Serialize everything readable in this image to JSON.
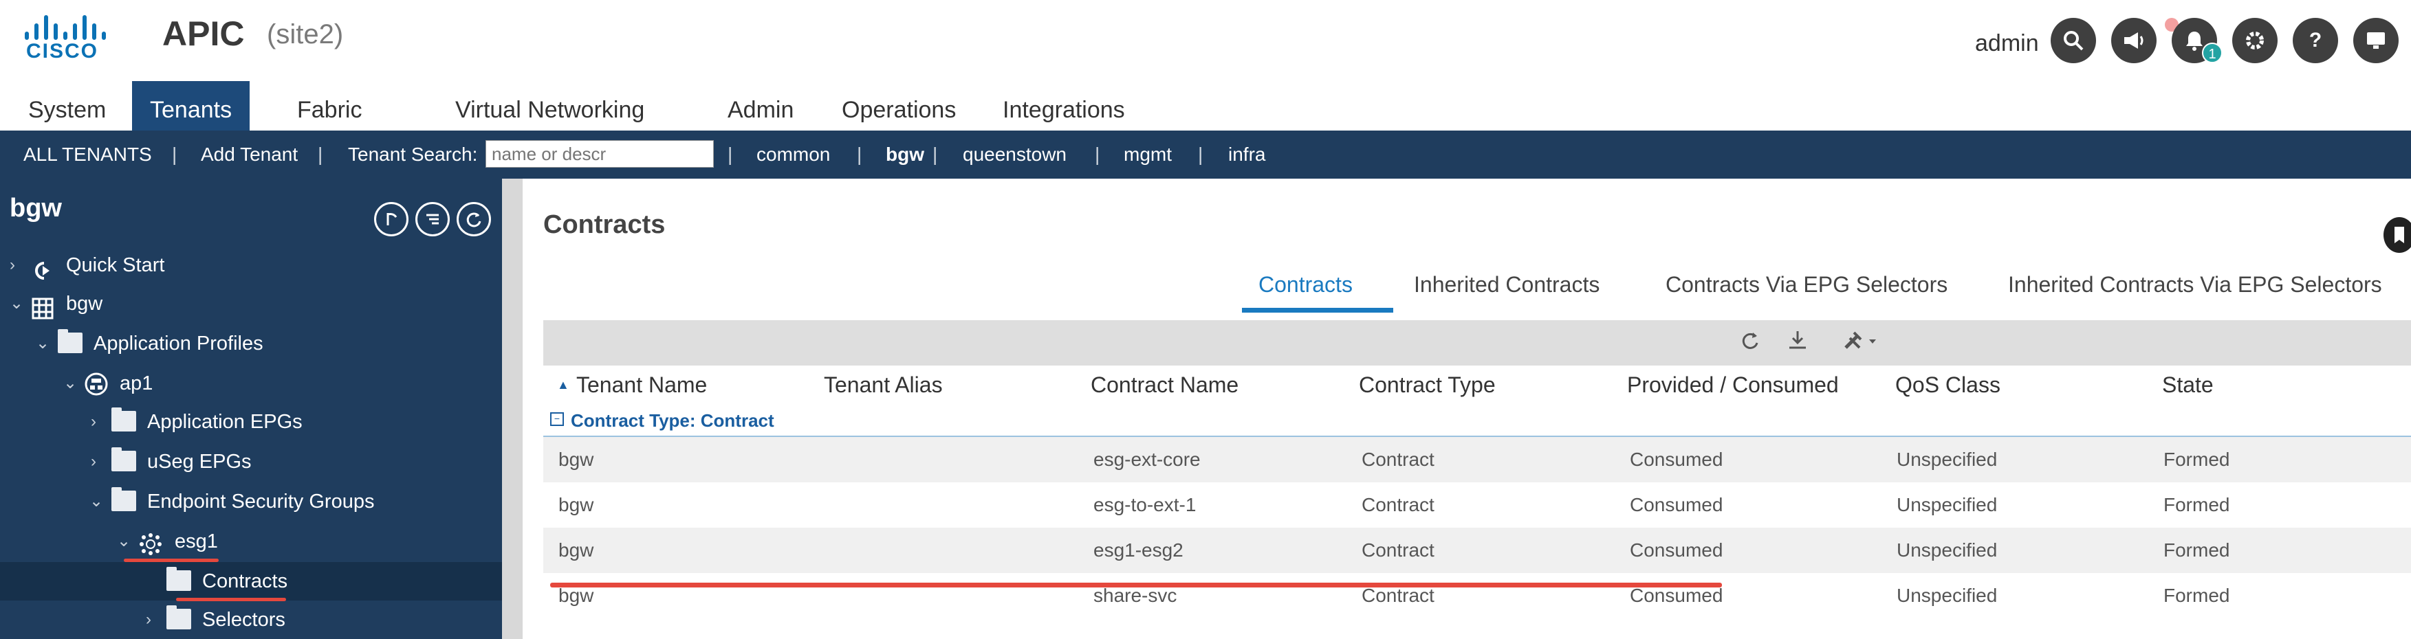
{
  "header": {
    "logo_text": "CISCO",
    "app_name": "APIC",
    "site": "(site2)",
    "user": "admin",
    "notification_count": "1",
    "icons": [
      "search-icon",
      "announcement-icon",
      "bell-icon",
      "gear-icon",
      "help-icon",
      "screen-icon"
    ]
  },
  "main_tabs": [
    "System",
    "Tenants",
    "Fabric",
    "Virtual Networking",
    "Admin",
    "Operations",
    "Integrations"
  ],
  "active_main_tab": "Tenants",
  "subnav": {
    "all_tenants": "ALL TENANTS",
    "add_tenant": "Add Tenant",
    "search_label": "Tenant Search:",
    "search_placeholder": "name or descr",
    "tenants": [
      "common",
      "bgw",
      "queenstown",
      "mgmt",
      "infra"
    ],
    "active_tenant": "bgw"
  },
  "sidebar": {
    "title": "bgw",
    "items": [
      {
        "label": "Quick Start",
        "icon": "quick-start-icon"
      },
      {
        "label": "bgw",
        "icon": "tenant-grid-icon"
      },
      {
        "label": "Application Profiles",
        "icon": "folder-icon"
      },
      {
        "label": "ap1",
        "icon": "app-profile-icon"
      },
      {
        "label": "Application EPGs",
        "icon": "folder-icon"
      },
      {
        "label": "uSeg EPGs",
        "icon": "folder-icon"
      },
      {
        "label": "Endpoint Security Groups",
        "icon": "folder-icon"
      },
      {
        "label": "esg1",
        "icon": "esg-icon"
      },
      {
        "label": "Contracts",
        "icon": "folder-icon"
      },
      {
        "label": "Selectors",
        "icon": "folder-icon"
      }
    ]
  },
  "content": {
    "title": "Contracts",
    "tabs": [
      "Contracts",
      "Inherited Contracts",
      "Contracts Via EPG Selectors",
      "Inherited Contracts Via EPG Selectors"
    ],
    "active_tab": "Contracts",
    "columns": [
      "Tenant Name",
      "Tenant Alias",
      "Contract Name",
      "Contract Type",
      "Provided / Consumed",
      "QoS Class",
      "State"
    ],
    "group_label": "Contract Type: Contract",
    "rows": [
      [
        "bgw",
        "",
        "esg-ext-core",
        "Contract",
        "Consumed",
        "Unspecified",
        "Formed"
      ],
      [
        "bgw",
        "",
        "esg-to-ext-1",
        "Contract",
        "Consumed",
        "Unspecified",
        "Formed"
      ],
      [
        "bgw",
        "",
        "esg1-esg2",
        "Contract",
        "Consumed",
        "Unspecified",
        "Formed"
      ],
      [
        "bgw",
        "",
        "share-svc",
        "Contract",
        "Consumed",
        "Unspecified",
        "Formed"
      ]
    ]
  },
  "colors": {
    "nav_dark": "#1f3d5e",
    "active_tab_blue": "#1a7ac0",
    "highlight_red": "#e5483d"
  }
}
